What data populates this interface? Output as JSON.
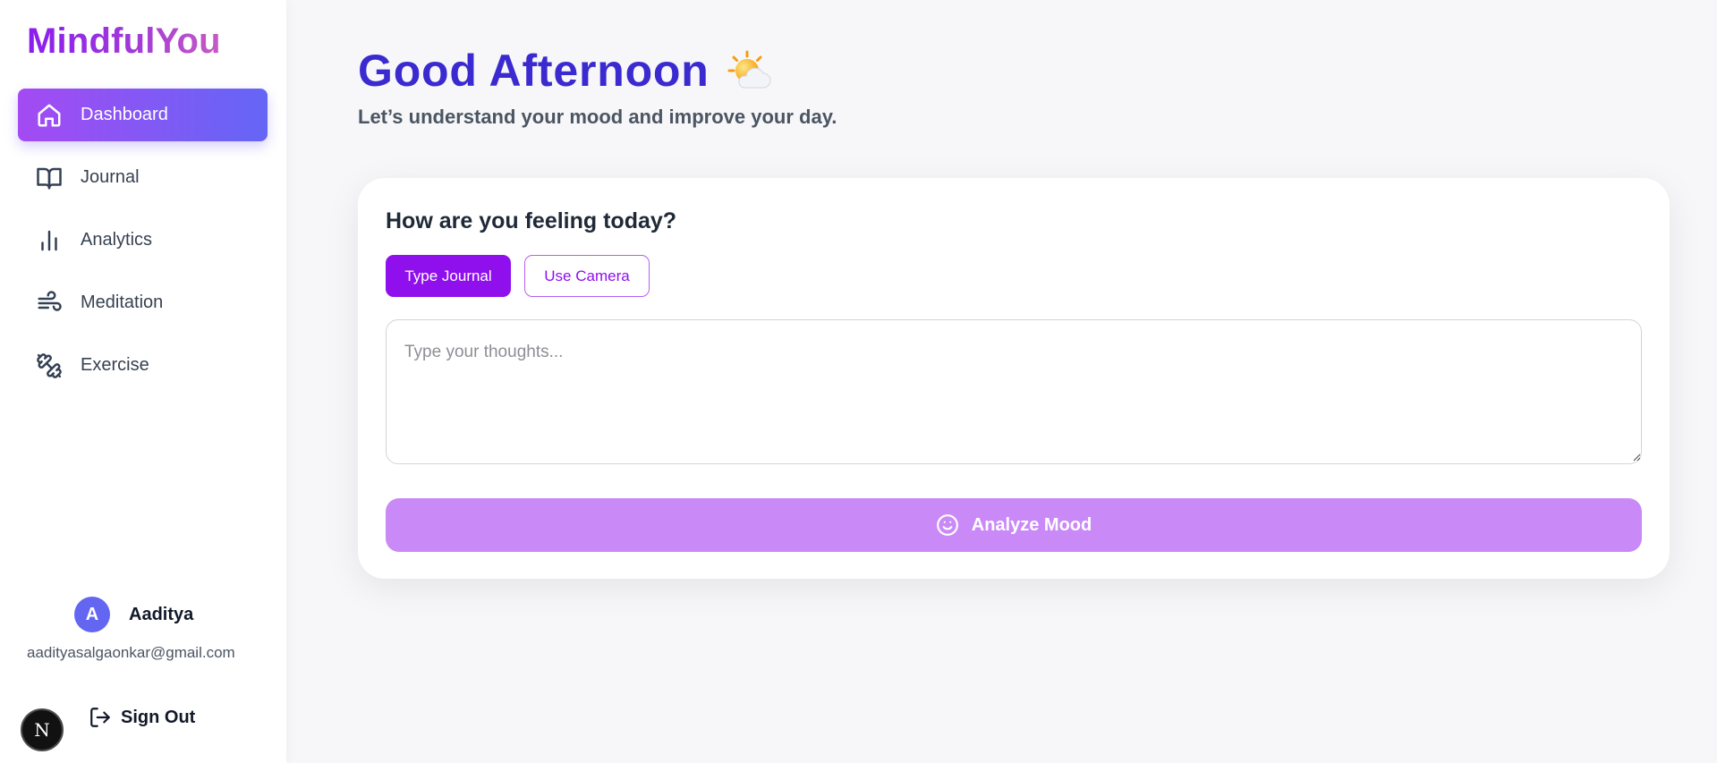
{
  "app": {
    "logo": "MindfulYou"
  },
  "sidebar": {
    "items": [
      {
        "label": "Dashboard",
        "icon": "home-icon",
        "active": true
      },
      {
        "label": "Journal",
        "icon": "book-icon"
      },
      {
        "label": "Analytics",
        "icon": "bar-chart-icon"
      },
      {
        "label": "Meditation",
        "icon": "wind-icon"
      },
      {
        "label": "Exercise",
        "icon": "dumbbell-icon"
      }
    ],
    "user": {
      "initial": "A",
      "name": "Aaditya",
      "email": "aadityasalgaonkar@gmail.com"
    },
    "signout_label": "Sign Out",
    "badge_letter": "N"
  },
  "main": {
    "greeting": "Good Afternoon",
    "greeting_icon": "sun-behind-cloud-icon",
    "subtitle": "Let’s understand your mood and improve your day.",
    "card": {
      "title": "How are you feeling today?",
      "tabs": [
        {
          "label": "Type Journal",
          "active": true
        },
        {
          "label": "Use Camera",
          "active": false
        }
      ],
      "input": {
        "value": "",
        "placeholder": "Type your thoughts..."
      },
      "analyze_label": "Analyze Mood"
    }
  },
  "colors": {
    "accent": "#8f10ec",
    "heading": "#3a2ad0",
    "nav_active_start": "#a44af3",
    "nav_active_end": "#6466f6",
    "analyze_button": "#c98af8",
    "avatar": "#6366f1"
  }
}
